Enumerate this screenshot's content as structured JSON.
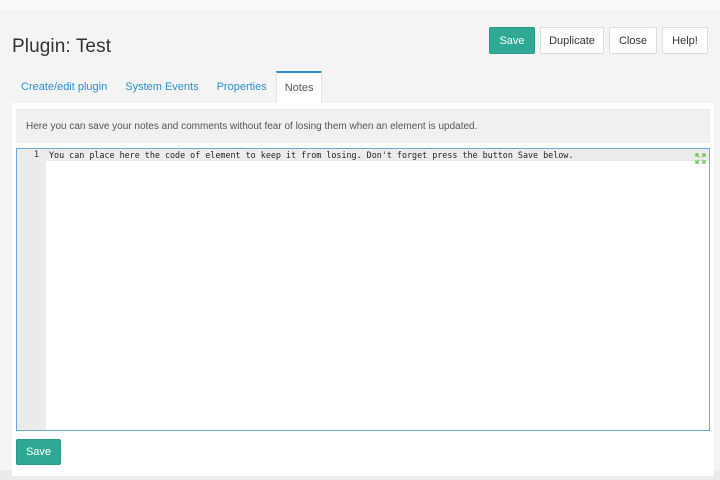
{
  "page": {
    "title": "Plugin: Test"
  },
  "toolbar": {
    "save_label": "Save",
    "duplicate_label": "Duplicate",
    "close_label": "Close",
    "help_label": "Help!"
  },
  "tabs": [
    {
      "label": "Create/edit plugin",
      "active": false
    },
    {
      "label": "System Events",
      "active": false
    },
    {
      "label": "Properties",
      "active": false
    },
    {
      "label": "Notes",
      "active": true
    }
  ],
  "notes": {
    "info_text": "Here you can save your notes and comments  without fear of losing them when an element is updated.",
    "editor": {
      "lines": [
        {
          "number": "1",
          "text": "You can place here the code of element to keep it from losing. Don't forget press the button Save below."
        }
      ],
      "fullscreen_icon": "expand-arrows-icon"
    },
    "save_label": "Save"
  },
  "colors": {
    "primary": "#2fa996",
    "link": "#2f8ec8",
    "editor_border": "#6fa8d6",
    "fullscreen_icon": "#6cc04a"
  }
}
